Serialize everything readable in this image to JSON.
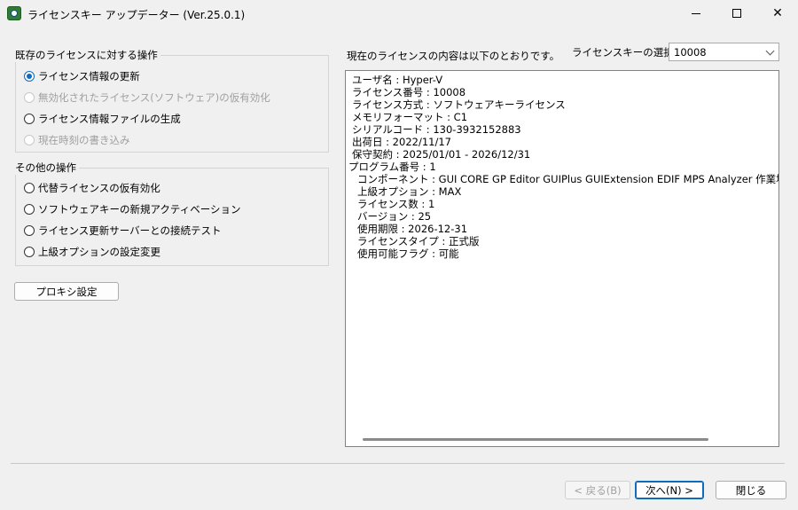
{
  "window": {
    "title": "ライセンスキー アップデーター (Ver.25.0.1)"
  },
  "existing_ops": {
    "title": "既存のライセンスに対する操作",
    "options": [
      {
        "label": "ライセンス情報の更新",
        "checked": true,
        "disabled": false
      },
      {
        "label": "無効化されたライセンス(ソフトウェア)の仮有効化",
        "checked": false,
        "disabled": true
      },
      {
        "label": "ライセンス情報ファイルの生成",
        "checked": false,
        "disabled": false
      },
      {
        "label": "現在時刻の書き込み",
        "checked": false,
        "disabled": true
      }
    ]
  },
  "other_ops": {
    "title": "その他の操作",
    "options": [
      {
        "label": "代替ライセンスの仮有効化",
        "checked": false,
        "disabled": false
      },
      {
        "label": "ソフトウェアキーの新規アクティベーション",
        "checked": false,
        "disabled": false
      },
      {
        "label": "ライセンス更新サーバーとの接続テスト",
        "checked": false,
        "disabled": false
      },
      {
        "label": "上級オプションの設定変更",
        "checked": false,
        "disabled": false
      }
    ]
  },
  "proxy_button": "プロキシ設定",
  "info_header": "現在のライセンスの内容は以下のとおりです。",
  "key_select": {
    "label": "ライセンスキーの選択",
    "value": "10008"
  },
  "license_info": {
    "lines": [
      "ユーザ名 : Hyper-V",
      "ライセンス番号 : 10008",
      "ライセンス方式 : ソフトウェアキーライセンス",
      "メモリフォーマット : C1",
      "シリアルコード : 130-3932152883",
      "出荷日 : 2022/11/17",
      "保守契約 : 2025/01/01 - 2026/12/31",
      "プログラム番号 : 1",
      "コンポーネント : GUI  CORE  GP  Editor  GUIPlus  GUIExtension  EDIF  MPS  Analyzer  作業場  AutoCalib",
      "上級オプション : MAX",
      "ライセンス数 : 1",
      "バージョン : 25",
      "使用期限 : 2026-12-31",
      "ライセンスタイプ : 正式版",
      "使用可能フラグ : 可能"
    ]
  },
  "footer": {
    "back": "< 戻る(B)",
    "next": "次へ(N) >",
    "close": "閉じる"
  },
  "colors": {
    "accent": "#0f6cbd",
    "window_bg": "#f0f0f0"
  }
}
